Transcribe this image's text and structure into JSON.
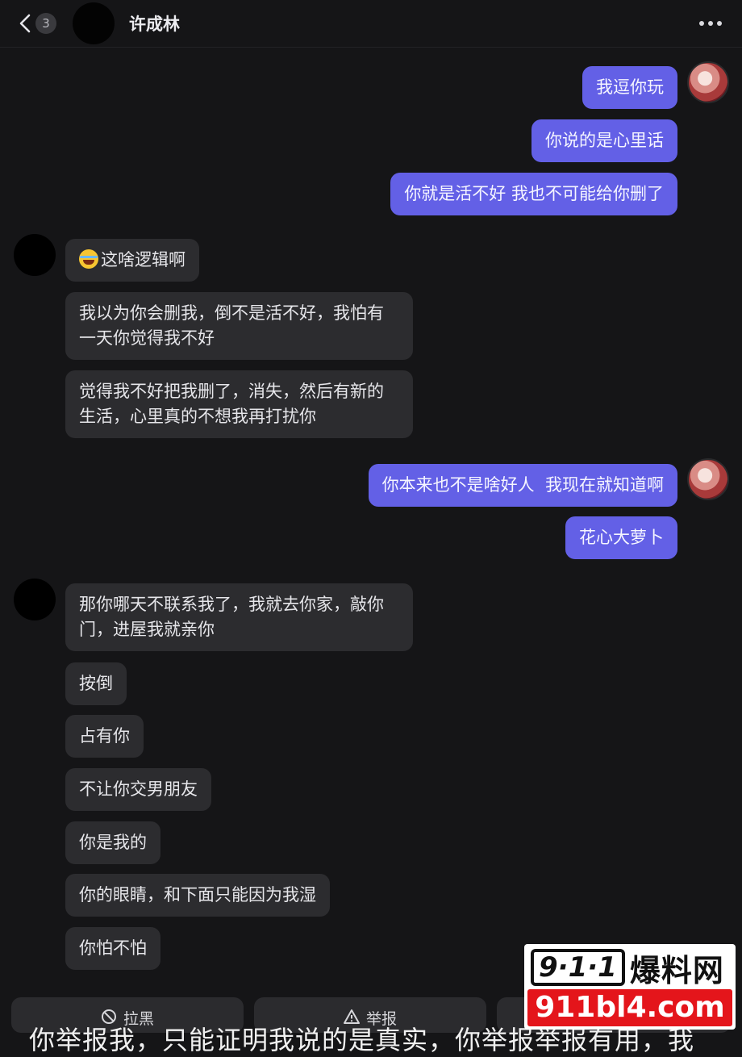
{
  "header": {
    "unread_count": "3",
    "title": "许成林"
  },
  "messages": [
    {
      "from": "me",
      "text": "我逗你玩"
    },
    {
      "from": "me",
      "text": "你说的是心里话"
    },
    {
      "from": "me",
      "text": "你就是活不好 我也不可能给你删了"
    },
    {
      "from": "peer",
      "emoji": "laughing-crying-emoji",
      "text": "这啥逻辑啊"
    },
    {
      "from": "peer",
      "text": "我以为你会删我，倒不是活不好，我怕有一天你觉得我不好"
    },
    {
      "from": "peer",
      "text": "觉得我不好把我删了，消失，然后有新的生活，心里真的不想我再打扰你"
    },
    {
      "from": "me",
      "text": "你本来也不是啥好人  我现在就知道啊"
    },
    {
      "from": "me",
      "text": "花心大萝卜"
    },
    {
      "from": "peer",
      "text": "那你哪天不联系我了，我就去你家，敲你门，进屋我就亲你"
    },
    {
      "from": "peer",
      "text": "按倒"
    },
    {
      "from": "peer",
      "text": "占有你"
    },
    {
      "from": "peer",
      "text": "不让你交男朋友"
    },
    {
      "from": "peer",
      "text": "你是我的"
    },
    {
      "from": "peer",
      "text": "你的眼睛，和下面只能因为我湿"
    },
    {
      "from": "peer",
      "text": "你怕不怕"
    }
  ],
  "actions": {
    "block_label": "拉黑",
    "report_label": "举报"
  },
  "caption": "你举报我，只能证明我说的是真实，你举报举报有用，我",
  "watermark": {
    "logo_number": "9·1·1",
    "logo_text": "爆料网",
    "url": "911bl4.com"
  },
  "colors": {
    "background": "#151517",
    "outgoing_bubble": "#6360e6",
    "incoming_bubble": "#2c2c2f",
    "watermark_red": "#e4151b"
  }
}
